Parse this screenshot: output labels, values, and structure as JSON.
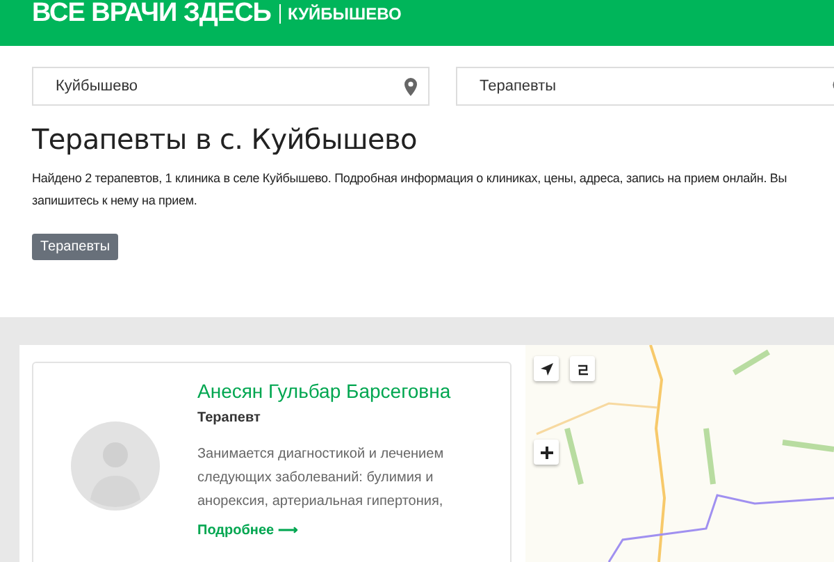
{
  "header": {
    "logo": "ВСЕ ВРАЧИ ЗДЕСЬ",
    "city": "КУЙБЫШЕВО"
  },
  "search": {
    "location": {
      "value": "Куйбышево"
    },
    "specialty": {
      "value": "Терапевты"
    }
  },
  "title": "Терапевты в с. Куйбышево",
  "description": "Найдено 2 терапевтов, 1 клиника в селе Куйбышево. Подробная информация о клиниках, цены, адреса, запись на прием онлайн. Вы\nзапишитесь к нему на прием.",
  "tags": [
    {
      "label": "Терапевты"
    }
  ],
  "doctors": [
    {
      "name": "Анесян Гульбар Барсеговна",
      "specialty": "Терапевт",
      "about": "Занимается диагностикой и лечением следующих заболеваний: булимия и анорексия, артериальная гипертония,",
      "link": "Подробнее ⟶"
    }
  ]
}
